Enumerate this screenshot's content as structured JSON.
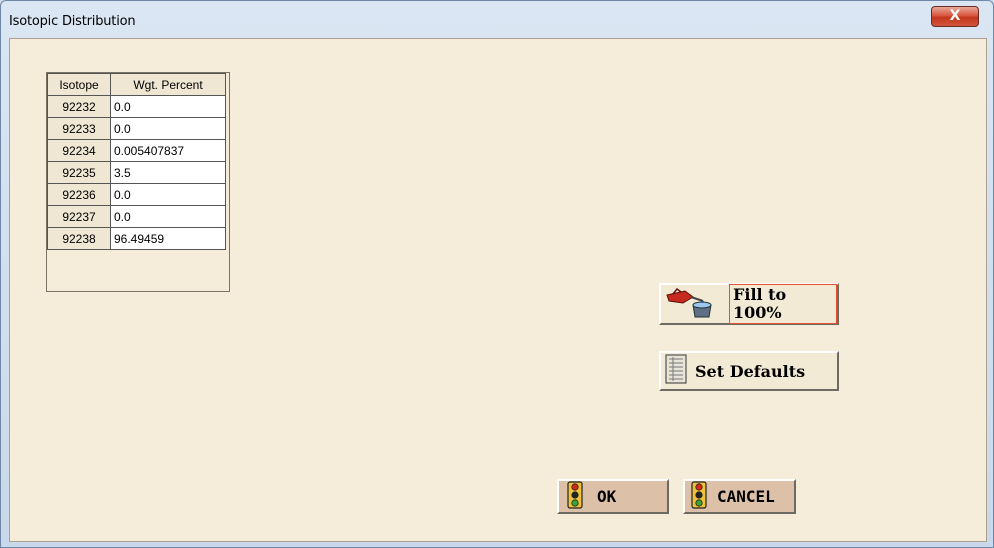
{
  "window": {
    "title": "Isotopic Distribution",
    "close_glyph": "X"
  },
  "table": {
    "headers": [
      "Isotope",
      "Wgt. Percent"
    ],
    "rows": [
      {
        "isotope": "92232",
        "percent": "0.0"
      },
      {
        "isotope": "92233",
        "percent": "0.0"
      },
      {
        "isotope": "92234",
        "percent": "0.005407837"
      },
      {
        "isotope": "92235",
        "percent": "3.5"
      },
      {
        "isotope": "92236",
        "percent": "0.0"
      },
      {
        "isotope": "92237",
        "percent": "0.0"
      },
      {
        "isotope": "92238",
        "percent": "96.49459"
      }
    ]
  },
  "buttons": {
    "fill": "Fill to 100%",
    "defaults": "Set Defaults",
    "ok": "OK",
    "cancel": "CANCEL"
  },
  "icons": {
    "fill": "gas-pump-nozzle-icon",
    "defaults": "list-document-icon",
    "ok": "traffic-light-icon",
    "cancel": "traffic-light-icon"
  },
  "colors": {
    "client_bg": "#f5ecd9",
    "button_tan": "#dcc0a8",
    "close_red": "#c3371d"
  }
}
